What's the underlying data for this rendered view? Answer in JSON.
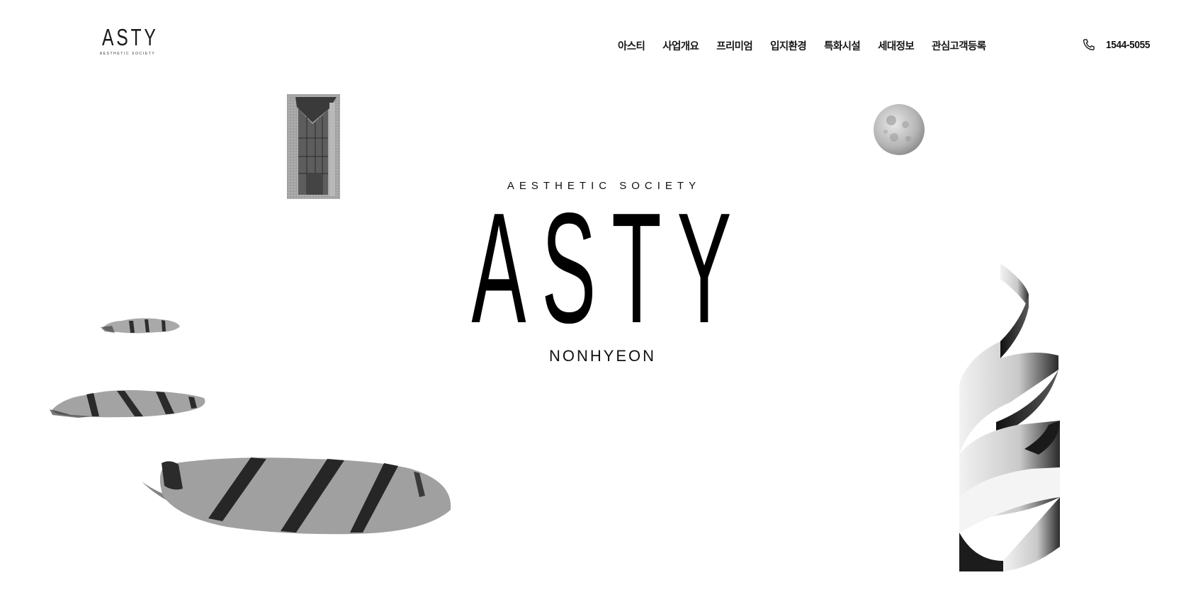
{
  "brand": {
    "logo_text": "ASTY",
    "logo_subtext": "AESTHETIC SOCIETY"
  },
  "nav": {
    "items": [
      {
        "label": "아스티"
      },
      {
        "label": "사업개요"
      },
      {
        "label": "프리미엄"
      },
      {
        "label": "입지환경"
      },
      {
        "label": "특화시설"
      },
      {
        "label": "세대정보"
      },
      {
        "label": "관심고객등록"
      }
    ]
  },
  "contact": {
    "icon": "phone-icon",
    "number": "1544-5055"
  },
  "hero": {
    "tagline": "AESTHETIC SOCIETY",
    "title": "ASTY",
    "subtitle": "NONHYEON"
  },
  "decor": {
    "items": [
      "building-image",
      "moon-image",
      "stone-small-image",
      "stone-medium-image",
      "stone-large-image",
      "ribbon-sculpture-image"
    ]
  },
  "colors": {
    "background": "#ffffff",
    "text": "#111111"
  }
}
